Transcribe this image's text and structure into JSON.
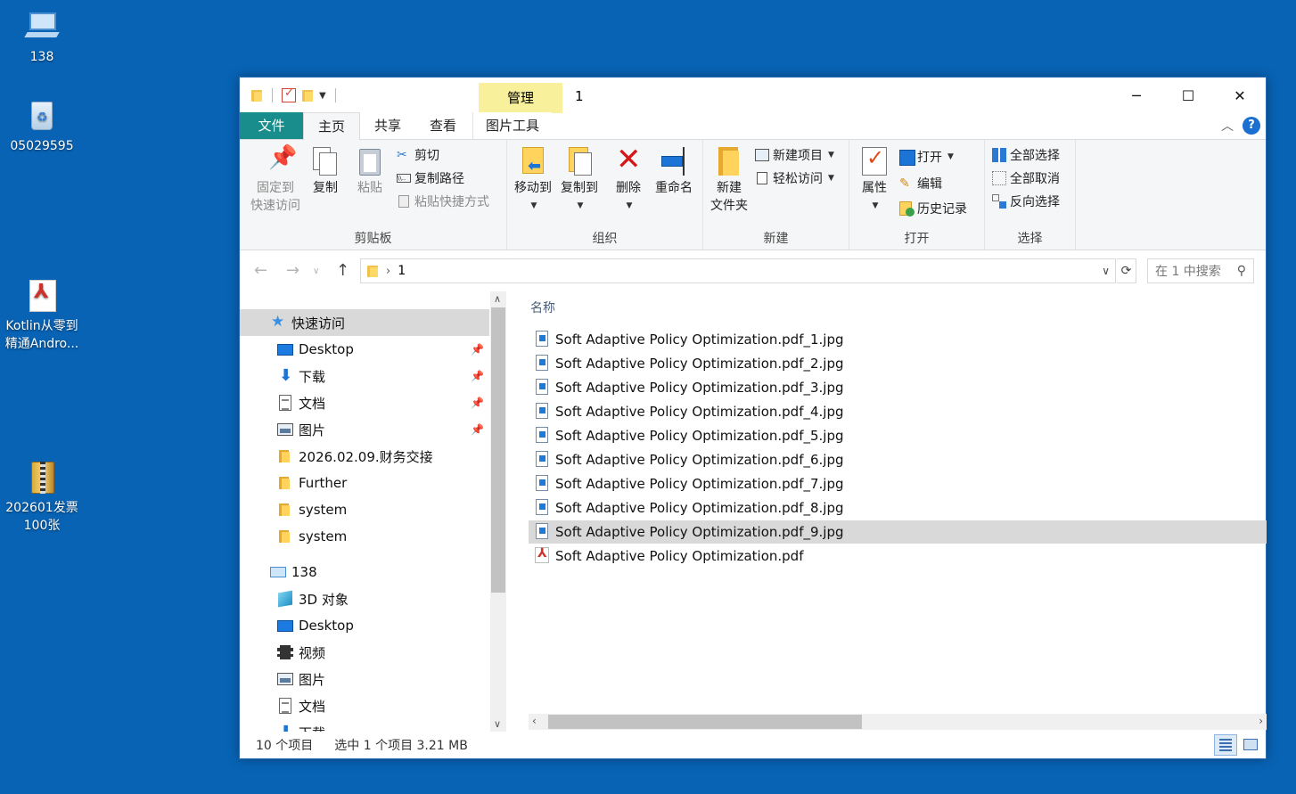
{
  "desktop": {
    "icons": [
      {
        "label": "138",
        "icon": "computer-icon"
      },
      {
        "label": "05029595",
        "icon": "recycle-bin-icon"
      },
      {
        "label": "Kotlin从零到\n精通Andro...",
        "line1": "Kotlin从零到",
        "line2": "精通Andro...",
        "icon": "pdf-icon"
      },
      {
        "line1": "202601发票",
        "line2": "100张",
        "icon": "archive-icon"
      }
    ]
  },
  "window": {
    "title": "1",
    "contextual_tab": "管理",
    "controls": {
      "minimize": "─",
      "maximize": "☐",
      "close": "✕"
    }
  },
  "ribbon_tabs": [
    "文件",
    "主页",
    "共享",
    "查看",
    "图片工具"
  ],
  "ribbon": {
    "clipboard": {
      "label": "剪贴板",
      "pin_line1": "固定到",
      "pin_line2": "快速访问",
      "copy": "复制",
      "paste": "粘贴",
      "cut": "剪切",
      "copy_path": "复制路径",
      "paste_shortcut": "粘贴快捷方式"
    },
    "organize": {
      "label": "组织",
      "move_to": "移动到",
      "copy_to": "复制到",
      "delete": "删除",
      "rename": "重命名"
    },
    "new": {
      "label": "新建",
      "new_folder_line1": "新建",
      "new_folder_line2": "文件夹",
      "new_item": "新建项目",
      "easy_access": "轻松访问"
    },
    "open": {
      "label": "打开",
      "properties": "属性",
      "open": "打开",
      "edit": "编辑",
      "history": "历史记录"
    },
    "select": {
      "label": "选择",
      "select_all": "全部选择",
      "select_none": "全部取消",
      "invert": "反向选择"
    }
  },
  "address": {
    "path": "1",
    "search_placeholder": "在 1 中搜索"
  },
  "nav_pane": {
    "quick_access": "快速访问",
    "items": [
      {
        "label": "Desktop",
        "pinned": true,
        "icon": "desktop-icon"
      },
      {
        "label": "下载",
        "pinned": true,
        "icon": "download-icon"
      },
      {
        "label": "文档",
        "pinned": true,
        "icon": "documents-icon"
      },
      {
        "label": "图片",
        "pinned": true,
        "icon": "pictures-icon"
      },
      {
        "label": "2026.02.09.财务交接",
        "pinned": false,
        "icon": "folder-icon"
      },
      {
        "label": "Further",
        "pinned": false,
        "icon": "folder-icon"
      },
      {
        "label": "system",
        "pinned": false,
        "icon": "folder-icon"
      },
      {
        "label": "system",
        "pinned": false,
        "icon": "folder-icon"
      }
    ],
    "this_pc": "138",
    "pc_items": [
      {
        "label": "3D 对象",
        "icon": "3d-objects-icon"
      },
      {
        "label": "Desktop",
        "icon": "desktop-icon"
      },
      {
        "label": "视频",
        "icon": "video-icon"
      },
      {
        "label": "图片",
        "icon": "pictures-icon"
      },
      {
        "label": "文档",
        "icon": "documents-icon"
      },
      {
        "label": "下载",
        "icon": "download-icon"
      }
    ]
  },
  "content": {
    "column_name": "名称",
    "files": [
      {
        "name": "Soft Adaptive Policy Optimization.pdf_1.jpg",
        "type": "jpg",
        "selected": false
      },
      {
        "name": "Soft Adaptive Policy Optimization.pdf_2.jpg",
        "type": "jpg",
        "selected": false
      },
      {
        "name": "Soft Adaptive Policy Optimization.pdf_3.jpg",
        "type": "jpg",
        "selected": false
      },
      {
        "name": "Soft Adaptive Policy Optimization.pdf_4.jpg",
        "type": "jpg",
        "selected": false
      },
      {
        "name": "Soft Adaptive Policy Optimization.pdf_5.jpg",
        "type": "jpg",
        "selected": false
      },
      {
        "name": "Soft Adaptive Policy Optimization.pdf_6.jpg",
        "type": "jpg",
        "selected": false
      },
      {
        "name": "Soft Adaptive Policy Optimization.pdf_7.jpg",
        "type": "jpg",
        "selected": false
      },
      {
        "name": "Soft Adaptive Policy Optimization.pdf_8.jpg",
        "type": "jpg",
        "selected": false
      },
      {
        "name": "Soft Adaptive Policy Optimization.pdf_9.jpg",
        "type": "jpg",
        "selected": true
      },
      {
        "name": "Soft Adaptive Policy Optimization.pdf",
        "type": "pdf",
        "selected": false
      }
    ]
  },
  "status": {
    "count": "10 个项目",
    "selection": "选中 1 个项目  3.21 MB"
  },
  "colors": {
    "desktop_bg": "#0863b5",
    "file_tab": "#198c8c",
    "manage_tab": "#f8f09a",
    "selection": "#d9d9d9"
  }
}
